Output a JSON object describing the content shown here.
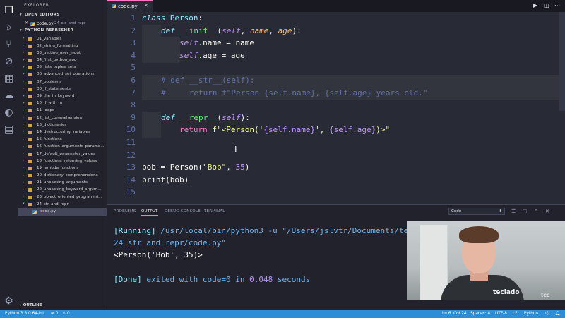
{
  "sidebar": {
    "title": "EXPLORER",
    "open_editors_label": "OPEN EDITORS",
    "open_editor": {
      "name": "code.py",
      "path": "24_str_and_repr"
    },
    "project_label": "PYTHON-REFRESHER",
    "items": [
      "01_variables",
      "02_string_formatting",
      "03_getting_user_input",
      "04_first_python_app",
      "05_lists_tuples_sets",
      "06_advanced_set_operations",
      "07_booleans",
      "08_if_statements",
      "09_the_in_keyword",
      "10_if_with_in",
      "11_loops",
      "12_list_comprehension",
      "13_dictionaries",
      "14_destructuring_variables",
      "15_functions",
      "16_function_arguments_parame...",
      "17_default_parameter_values",
      "18_functions_returning_values",
      "19_lambda_functions",
      "20_dictionary_comprehensions",
      "21_unpacking_arguments",
      "22_unpacking_keyword_argum...",
      "23_object_oriented_programmi...",
      "24_str_and_repr"
    ],
    "file": "code.py",
    "outline_label": "OUTLINE"
  },
  "tab": {
    "label": "code.py"
  },
  "editor": {
    "line_numbers": [
      "1",
      "2",
      "3",
      "4",
      "5",
      "6",
      "7",
      "8",
      "9",
      "10",
      "11",
      "12",
      "13",
      "14",
      "15"
    ],
    "lines": {
      "l1": {
        "kw": "class",
        "name": " Person",
        "rest": ":"
      },
      "l2": {
        "kw": "def",
        "fn": " __init__",
        "p1": "(",
        "self": "self",
        "c1": ", ",
        "pa": "name",
        "c2": ", ",
        "pb": "age",
        "end": "):"
      },
      "l3": {
        "self": "self",
        "rest": ".name = name"
      },
      "l4": {
        "self": "self",
        "rest": ".age = age"
      },
      "l6": "# def __str__(self):",
      "l7": "#     return f\"Person {self.name}, {self.age} years old.\"",
      "l9": {
        "kw": "def",
        "fn": " __repr__",
        "p1": "(",
        "self": "self",
        "end": "):"
      },
      "l10": {
        "kw": "return",
        "sp": " ",
        "fs": "f\"<Person('",
        "b1": "{self.name}",
        "mid": "', ",
        "b2": "{self.age}",
        "tail": ")>\""
      },
      "l13": {
        "a": "bob = Person(",
        "s": "\"Bob\"",
        "c": ", ",
        "n": "35",
        "e": ")"
      },
      "l14": {
        "a": "print(bob)"
      }
    }
  },
  "panel": {
    "tabs": [
      "PROBLEMS",
      "OUTPUT",
      "DEBUG CONSOLE",
      "TERMINAL"
    ],
    "select_value": "Code",
    "output": {
      "run_tag": "[Running]",
      "run_cmd": " /usr/local/bin/python3 -u \"/Users/jslvtr/Documents/tecla",
      "run_cmd2": "24_str_and_repr/code.py\"",
      "result": "<Person('Bob', 35)>",
      "done_tag": "[Done]",
      "done_a": " exited with ",
      "done_code": "code=0",
      "done_b": " in ",
      "done_time": "0.048",
      "done_c": " seconds"
    }
  },
  "webcam": {
    "logo": "teclado",
    "logo2": "tec"
  },
  "statusbar": {
    "python": "Python 3.8.0 64-bit",
    "errors": "⊗ 0",
    "warnings": "⚠ 0",
    "position": "Ln 6, Col 24",
    "spaces": "Spaces: 4",
    "encoding": "UTF-8",
    "eol": "LF",
    "language": "Python"
  }
}
